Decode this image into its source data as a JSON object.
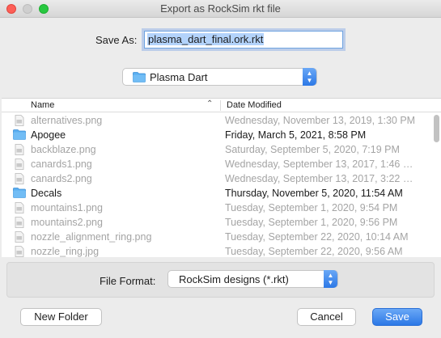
{
  "window": {
    "title": "Export as RockSim rkt file"
  },
  "save_as": {
    "label": "Save As:",
    "value": "plasma_dart_final.ork.rkt"
  },
  "location": {
    "value": "Plasma Dart",
    "icon": "folder-icon"
  },
  "columns": {
    "name": "Name",
    "date": "Date Modified"
  },
  "files": [
    {
      "name": "alternatives.png",
      "date": "Wednesday, November 13, 2019, 1:30 PM",
      "kind": "file"
    },
    {
      "name": "Apogee",
      "date": "Friday, March 5, 2021, 8:58 PM",
      "kind": "folder"
    },
    {
      "name": "backblaze.png",
      "date": "Saturday, September 5, 2020, 7:19 PM",
      "kind": "file"
    },
    {
      "name": "canards1.png",
      "date": "Wednesday, September 13, 2017, 1:46 …",
      "kind": "file"
    },
    {
      "name": "canards2.png",
      "date": "Wednesday, September 13, 2017, 3:22 …",
      "kind": "file"
    },
    {
      "name": "Decals",
      "date": "Thursday, November 5, 2020, 11:54 AM",
      "kind": "folder"
    },
    {
      "name": "mountains1.png",
      "date": "Tuesday, September 1, 2020, 9:54 PM",
      "kind": "file"
    },
    {
      "name": "mountains2.png",
      "date": "Tuesday, September 1, 2020, 9:56 PM",
      "kind": "file"
    },
    {
      "name": "nozzle_alignment_ring.png",
      "date": "Tuesday, September 22, 2020, 10:14 AM",
      "kind": "file"
    },
    {
      "name": "nozzle_ring.jpg",
      "date": "Tuesday, September 22, 2020, 9:56 AM",
      "kind": "file"
    }
  ],
  "file_format": {
    "label": "File Format:",
    "value": "RockSim designs (*.rkt)"
  },
  "buttons": {
    "new_folder": "New Folder",
    "cancel": "Cancel",
    "save": "Save"
  },
  "colors": {
    "accent": "#2c78e6",
    "folder": "#5aaef0",
    "dimmed_text": "#a4a4a4"
  }
}
